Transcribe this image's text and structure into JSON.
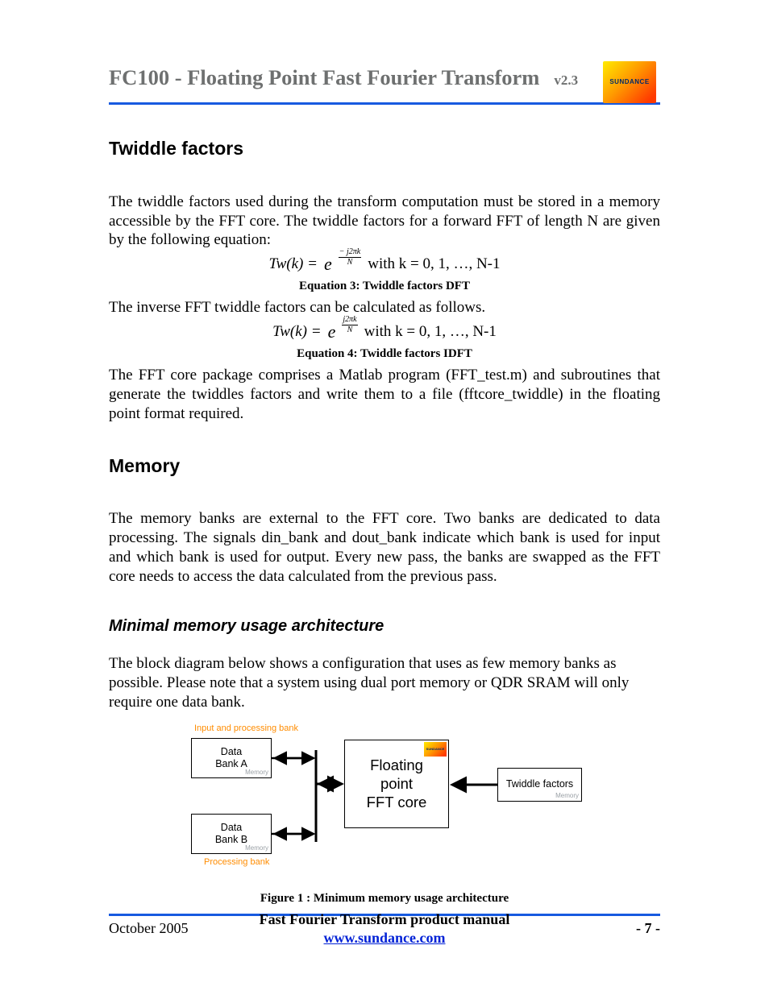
{
  "header": {
    "title": "FC100 - Floating Point Fast Fourier Transform",
    "version": "v2.3",
    "logo_text": "SUNDANCE"
  },
  "sections": {
    "twiddle": {
      "heading": "Twiddle factors",
      "p1": "The twiddle factors used during the transform computation must be stored in a memory accessible by the FFT core. The twiddle factors for a forward FFT of length N are given by the following equation:",
      "eq1_prefix": "Tw(k) = ",
      "eq1_frac_num": "− j2πk",
      "eq1_frac_den": "N",
      "eq1_suffix": " with k = 0, 1, …, N-1",
      "eq1_caption": "Equation 3: Twiddle factors DFT",
      "p2": "The inverse FFT twiddle factors can be calculated as follows.",
      "eq2_prefix": "Tw(k) = ",
      "eq2_frac_num": "j2πk",
      "eq2_frac_den": "N",
      "eq2_suffix": " with k = 0, 1, …, N-1",
      "eq2_caption": "Equation 4: Twiddle factors IDFT",
      "p3": "The FFT core package comprises a Matlab program (FFT_test.m) and subroutines that generate the twiddles factors and write them to a file (fftcore_twiddle) in the floating point format required."
    },
    "memory": {
      "heading": "Memory",
      "p1": "The memory banks are external to the FFT core. Two banks are dedicated to data processing. The signals din_bank and dout_bank indicate which bank is used for input and which bank is used for output. Every new pass, the banks are swapped as the FFT core needs to access the data calculated from the previous pass."
    },
    "minmem": {
      "heading": "Minimal memory usage architecture",
      "p1": "The block diagram below shows a configuration that uses as few memory banks as possible. Please note that a system using dual port memory or QDR SRAM will only require one data bank."
    }
  },
  "figure": {
    "label_top": "Input and processing bank",
    "label_bottom": "Processing bank",
    "bank_a_l1": "Data",
    "bank_a_l2": "Bank A",
    "bank_b_l1": "Data",
    "bank_b_l2": "Bank B",
    "twiddle_label": "Twiddle factors",
    "memory_tag": "Memory",
    "core_l1": "Floating",
    "core_l2": "point",
    "core_l3": "FFT core",
    "core_logo": "SUNDANCE",
    "caption": "Figure 1 : Minimum memory usage architecture"
  },
  "footer": {
    "date": "October 2005",
    "manual": "Fast Fourier Transform product manual",
    "url": "www.sundance.com",
    "page": "- 7 -"
  }
}
